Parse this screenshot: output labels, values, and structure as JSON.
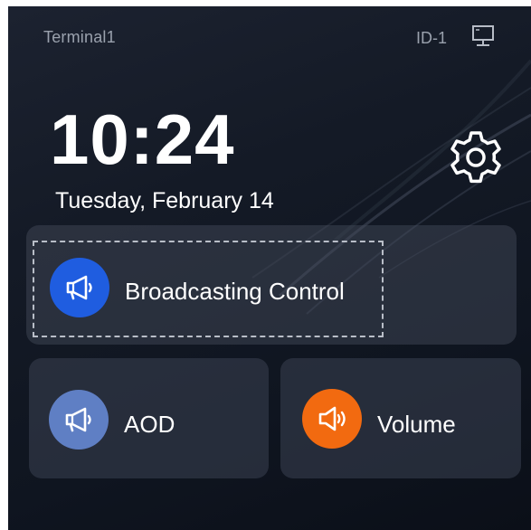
{
  "status_bar": {
    "terminal_name": "Terminal1",
    "device_id": "ID-1",
    "monitor_icon": "monitor-icon"
  },
  "clock": {
    "time": "10:24",
    "date": "Tuesday, February 14"
  },
  "settings": {
    "icon": "gear-icon"
  },
  "tiles": {
    "broadcast": {
      "label": "Broadcasting Control",
      "icon": "megaphone-icon",
      "icon_color": "#1f5de0"
    },
    "aod": {
      "label": "AOD",
      "icon": "megaphone-icon",
      "icon_color": "#5f7fc4"
    },
    "volume": {
      "label": "Volume",
      "icon": "speaker-icon",
      "icon_color": "#f26a10"
    }
  },
  "colors": {
    "background": "#141a26",
    "card": "#3a4252",
    "text_primary": "#ffffff",
    "text_secondary": "#9aa1ad"
  }
}
